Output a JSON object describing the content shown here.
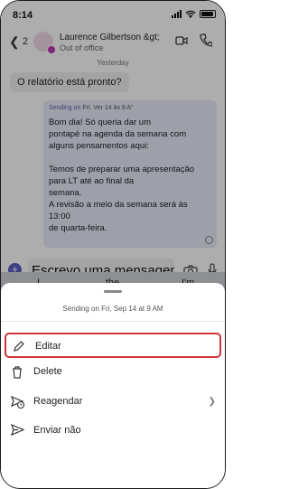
{
  "status": {
    "time": "8:14"
  },
  "header": {
    "back_count": "2",
    "contact_name": "Laurence Gilbertson &gt;",
    "contact_status": "Out of office"
  },
  "chat": {
    "date_label": "Yesterday",
    "incoming_message": "O relatório está pronto?",
    "scheduled_prefix": "Sending on",
    "scheduled_date": "Fri. Ver 14 às 8 A\"",
    "outgoing_message": "Bom dia! Só queria dar um\npontapé na agenda da semana com\nalguns pensamentos aqui:\n\nTemos de preparar uma apresentação\npara LT até ao final da\nsemana.\nA revisão a meio da semana será às 13:00\nde quarta-feira."
  },
  "composer": {
    "text": "Escrevo uma mensagem"
  },
  "keyboard": {
    "suggestions": [
      "I",
      "the",
      "I'm"
    ]
  },
  "sheet": {
    "title": "Sending on Fri, Sep 14 at 9 AM",
    "items": [
      {
        "label": "Editar",
        "icon": "pencil-icon"
      },
      {
        "label": "Delete",
        "icon": "trash-icon"
      },
      {
        "label": "Reagendar",
        "icon": "reschedule-icon"
      },
      {
        "label": "Enviar não",
        "icon": "send-icon"
      }
    ]
  },
  "colors": {
    "accent": "#5b5fc7",
    "highlight": "#d13438",
    "bubble_out": "#e8ebfa"
  }
}
